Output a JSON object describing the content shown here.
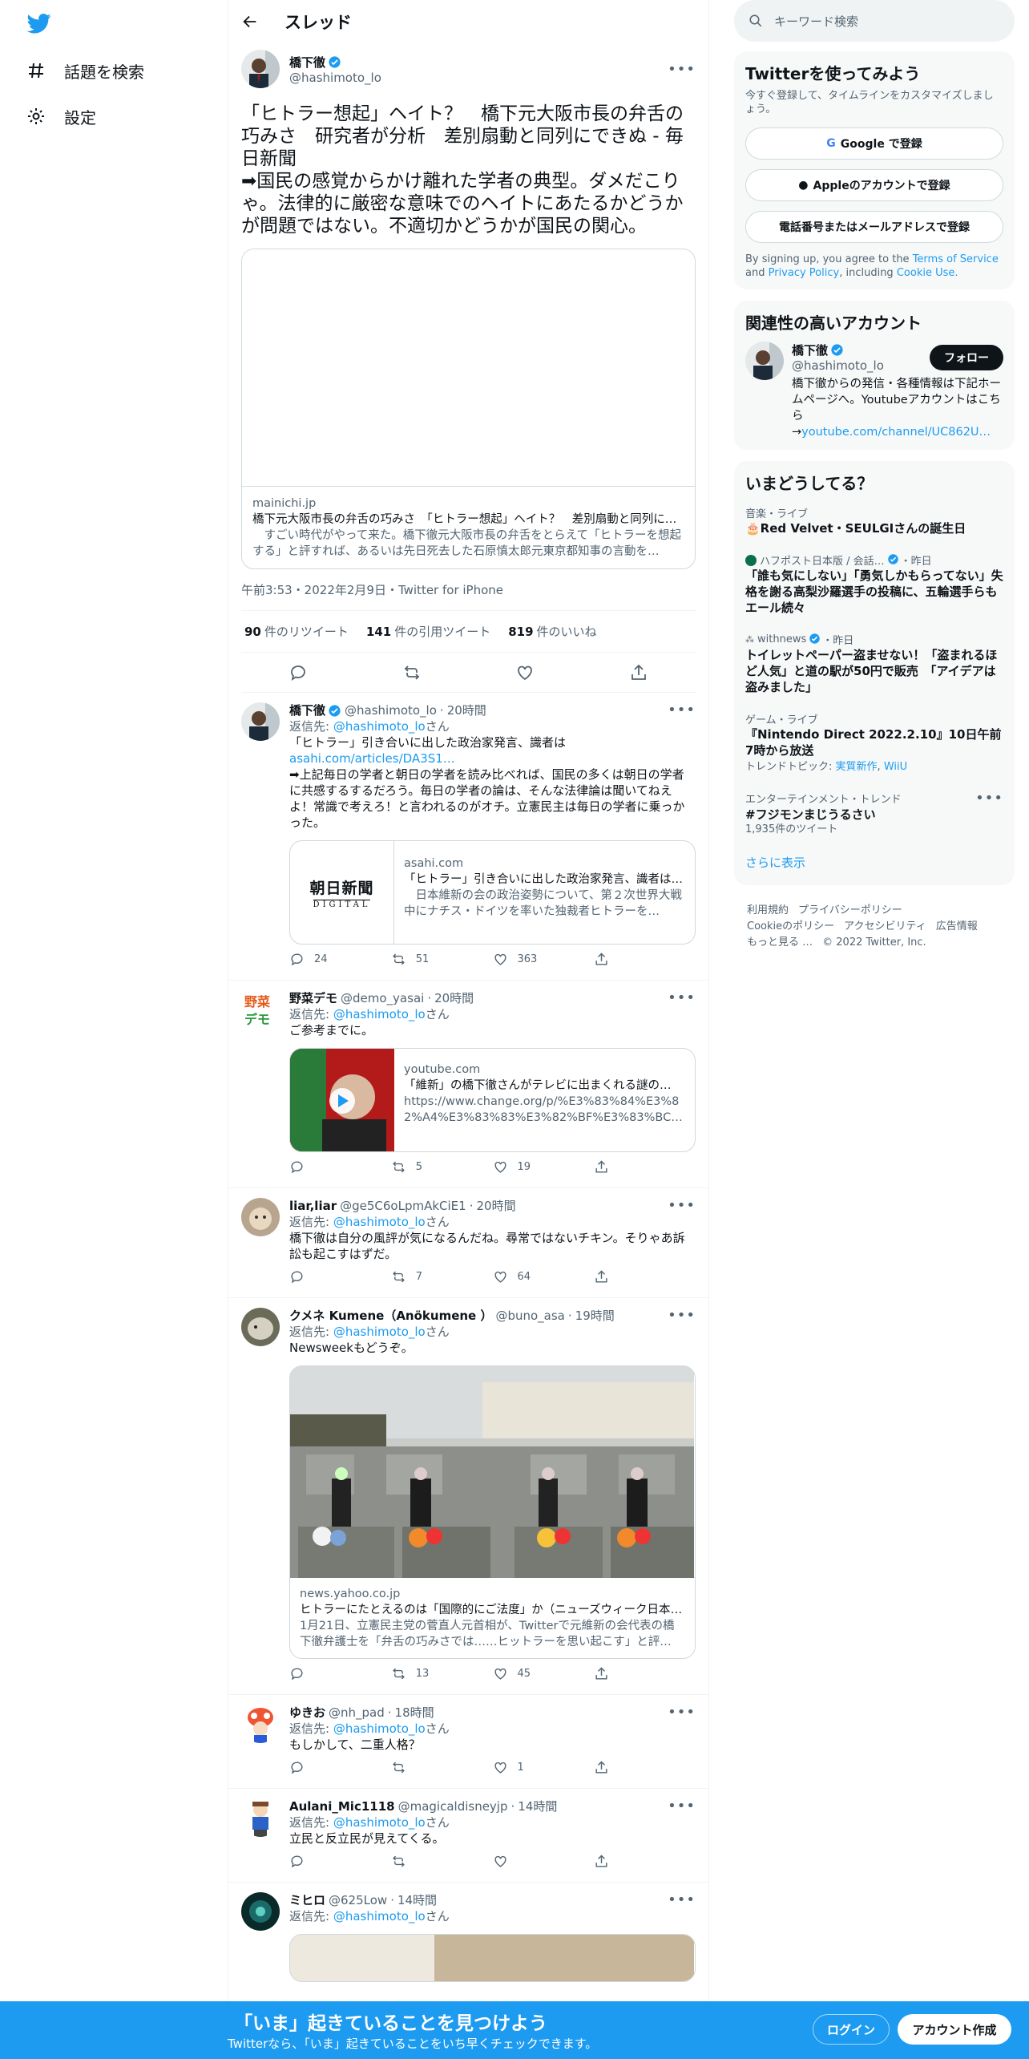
{
  "nav": {
    "explore": "話題を検索",
    "settings": "設定"
  },
  "header": {
    "title": "スレッド"
  },
  "main_tweet": {
    "name": "橋下徹",
    "handle": "@hashimoto_lo",
    "text": "「ヒトラー想起」ヘイト？　橋下元大阪市長の弁舌の巧みさ　研究者が分析　差別扇動と同列にできぬ - 毎日新聞\n➡国民の感覚からかけ離れた学者の典型。ダメだこりゃ。法律的に厳密な意味でのヘイトにあたるかどうかが問題ではない。不適切かどうかが国民の関心。",
    "card": {
      "domain": "mainichi.jp",
      "title": "橋下元大阪市長の弁舌の巧みさ　「ヒトラー想起」ヘイト？　差別扇動と同列にできぬ",
      "desc": "　すごい時代がやって来た。橋下徹元大阪市長の弁舌をとらえて「ヒトラーを想起する」と評すれば、あるいは先日死去した石原慎太郎元東京都知事の言動を…"
    },
    "meta": "午前3:53・2022年2月9日・Twitter for iPhone",
    "retweets": "90",
    "retweets_label": "件のリツイート",
    "quotes": "141",
    "quotes_label": "件の引用ツイート",
    "likes": "819",
    "likes_label": "件のいいね"
  },
  "reply_to_label": "返信先:",
  "reply_to_handle": "@hashimoto_lo",
  "reply_to_suffix": "さん",
  "replies": [
    {
      "name": "橋下徹",
      "handle": "@hashimoto_lo",
      "time": "20時間",
      "text_before": "「ヒトラー」引き合いに出した政治家発言、識者は",
      "link": "asahi.com/articles/DA3S1…",
      "text_after": "➡上記毎日の学者と朝日の学者を読み比べれば、国民の多くは朝日の学者に共感するするだろう。毎日の学者の論は、そんな法律論は聞いてねえよ！常識で考えろ！と言われるのがオチ。立憲民主は毎日の学者に乗っかった。",
      "card": {
        "thumb": "朝日新聞",
        "thumb2": "DIGITAL",
        "domain": "asahi.com",
        "title": "「ヒトラー」引き合いに出した政治家発言、識者は：朝日新聞デジタル",
        "desc": "　日本維新の会の政治姿勢について、第２次世界大戦中にナチス・ドイツを率いた独裁者ヒトラーを…"
      },
      "reply_count": "24",
      "rt_count": "51",
      "like_count": "363"
    },
    {
      "name": "野菜デモ",
      "handle": "@demo_yasai",
      "time": "20時間",
      "text": "ご参考までに。",
      "card": {
        "domain": "youtube.com",
        "title": "「維新」の橋下徹さんがテレビに出まくれる謎の…",
        "desc": "https://www.change.org/p/%E3%83%84%E3%82%A4%E3%83%83%E3%82%BF%E3%83%BC%E6%B0…"
      },
      "reply_count": "",
      "rt_count": "5",
      "like_count": "19"
    },
    {
      "name": "liar,liar",
      "handle": "@ge5C6oLpmAkCiE1",
      "time": "20時間",
      "text": "橋下徹は自分の風評が気になるんだね。尋常ではないチキン。そりゃあ訴訟も起こすはずだ。",
      "reply_count": "",
      "rt_count": "7",
      "like_count": "64"
    },
    {
      "name": "クメネ Kumene（Anökumene ）",
      "handle": "@buno_asa",
      "time": "19時間",
      "text": "Newsweekもどうぞ。",
      "card": {
        "domain": "news.yahoo.co.jp",
        "title": "ヒトラーにたとえるのは「国際的にご法度」か（ニューズウィーク日本版）",
        "desc": "1月21日、立憲民主党の菅直人元首相が、Twitterで元維新の会代表の橋下徹弁護士を「弁舌の巧みさでは……ヒットラーを思い起こす」と評…"
      },
      "reply_count": "",
      "rt_count": "13",
      "like_count": "45"
    },
    {
      "name": "ゆきお",
      "handle": "@nh_pad",
      "time": "18時間",
      "text": "もしかして、二重人格？",
      "reply_count": "",
      "rt_count": "",
      "like_count": "1"
    },
    {
      "name": "Aulani_Mic1118",
      "handle": "@magicaldisneyjp",
      "time": "14時間",
      "text": "立民と反立民が見えてくる。",
      "reply_count": "",
      "rt_count": "",
      "like_count": ""
    },
    {
      "name": "ミヒロ",
      "handle": "@625Low",
      "time": "14時間",
      "text": ""
    }
  ],
  "right": {
    "search_placeholder": "キーワード検索",
    "signup": {
      "title": "Twitterを使ってみよう",
      "desc": "今すぐ登録して、タイムラインをカスタマイズしましょう。",
      "google": "Google で登録",
      "apple": "Appleのアカウントで登録",
      "phone": "電話番号またはメールアドレスで登録",
      "terms_pre": "By signing up, you agree to the",
      "terms": "Terms of Service",
      "and": "and",
      "privacy": "Privacy Policy",
      "including": ", including",
      "cookie": "Cookie Use."
    },
    "related": {
      "title": "関連性の高いアカウント",
      "name": "橋下徹",
      "handle": "@hashimoto_lo",
      "follow": "フォロー",
      "bio": "橋下徹からの発信・各種情報は下記ホームページへ。Youtubeアカウントはこちら\n→",
      "bio_link": "youtube.com/channel/UC862U…"
    },
    "trends": {
      "title": "いまどうしてる？",
      "items": [
        {
          "cat": "音楽・ライブ",
          "title": "🎂Red Velvet・SEULGIさんの誕生日"
        },
        {
          "cat": "ハフポスト日本版 / 会話…",
          "cat_time": "・昨日",
          "title": "「誰も気にしない」「勇気しかもらってない」失格を謝る高梨沙羅選手の投稿に、五輪選手らもエール続々"
        },
        {
          "cat": "withnews",
          "cat_time": "・昨日",
          "title": "トイレットペーパー盗ませない！「盗まれるほど人気」と道の駅が50円で販売　「アイデアは盗みました」"
        },
        {
          "cat": "ゲーム・ライブ",
          "title": "『Nintendo Direct 2022.2.10』10日午前7時から放送",
          "sub_label": "トレンドトピック:",
          "sub1": "実質新作",
          "sub2": "WiiU"
        },
        {
          "cat": "エンターテインメント・トレンド",
          "title": "#フジモンまじうるさい",
          "sub": "1,935件のツイート"
        }
      ],
      "more": "さらに表示"
    },
    "footer": [
      "利用規約",
      "プライバシーポリシー",
      "Cookieのポリシー",
      "アクセシビリティ",
      "広告情報",
      "もっと見る …",
      "© 2022 Twitter, Inc."
    ]
  },
  "bottom_bar": {
    "title": "「いま」起きていることを見つけよう",
    "subtitle": "Twitterなら、「いま」起きていることをいち早くチェックできます。",
    "login": "ログイン",
    "signup": "アカウント作成"
  },
  "colors": {
    "accent": "#1d9bf0",
    "text": "#0f1419",
    "muted": "#536471",
    "border": "#cfd9de"
  }
}
